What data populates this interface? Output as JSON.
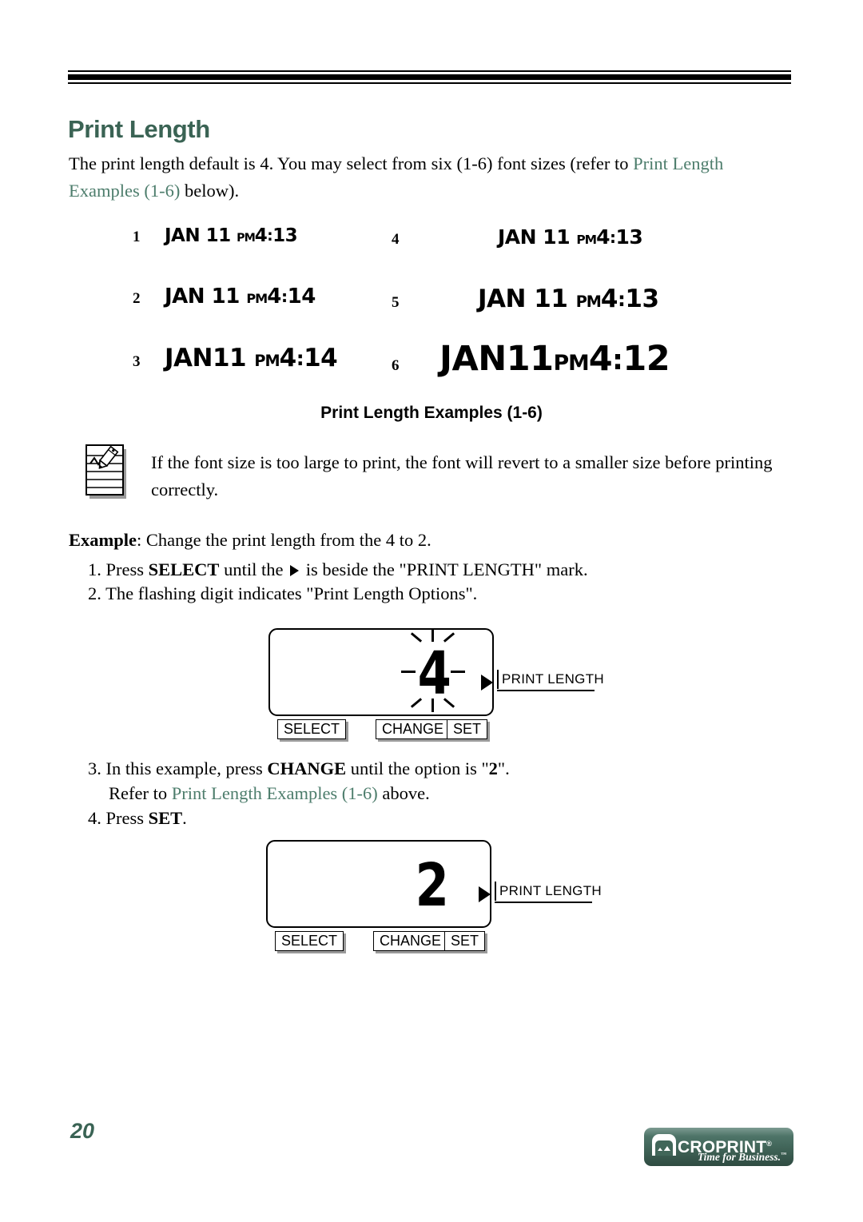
{
  "header": {
    "title": "Print Length"
  },
  "intro": {
    "part1": "The print length default is 4. You may select from six (1-6) font sizes (refer to ",
    "xref": "Print Length Examples (1-6)",
    "part2": " below)."
  },
  "examples": {
    "caption": "Print Length Examples (1-6)",
    "items": [
      {
        "num": "1",
        "month": "JAN",
        "day": "11",
        "meridiem": "PM",
        "hour": "4",
        "minute": "13",
        "text": "JAN 11 PM4:13"
      },
      {
        "num": "2",
        "month": "JAN",
        "day": "11",
        "meridiem": "PM",
        "hour": "4",
        "minute": "14",
        "text": "JAN 11 PM4:14"
      },
      {
        "num": "3",
        "month": "JAN",
        "day": "11",
        "meridiem": "PM",
        "hour": "4",
        "minute": "14",
        "text": "JAN 11 PM4:14"
      },
      {
        "num": "4",
        "month": "JAN",
        "day": "11",
        "meridiem": "PM",
        "hour": "4",
        "minute": "13",
        "text": "JAN 11 PM4:13"
      },
      {
        "num": "5",
        "month": "JAN",
        "day": "11",
        "meridiem": "PM",
        "hour": "4",
        "minute": "13",
        "text": "JAN 11 PM4:13"
      },
      {
        "num": "6",
        "month": "JAN",
        "day": "11",
        "meridiem": "PM",
        "hour": "4",
        "minute": "12",
        "text": "JAN 11 PM4:12"
      }
    ]
  },
  "note": {
    "icon": "notepad-pencil-icon",
    "text": "If the font size is too large to print, the font will revert to a smaller size before printing correctly."
  },
  "procedure": {
    "lead_label": "Example",
    "lead_rest": ": Change the print length from the 4 to 2.",
    "step1_a": "1. Press ",
    "step1_bold": "SELECT",
    "step1_b": " until the ",
    "step1_c": " is beside the \"PRINT LENGTH\" mark.",
    "step2": "2. The flashing digit indicates \"Print Length Options\".",
    "step3_a": "3. In this example, press ",
    "step3_bold": "CHANGE",
    "step3_b": " until the option is \"",
    "step3_value": "2",
    "step3_c": "\".",
    "step3_refer_a": "Refer to ",
    "step3_refer_xref": "Print Length Examples (1-6)",
    "step3_refer_b": " above.",
    "step4_a": "4. Press ",
    "step4_bold": "SET",
    "step4_b": "."
  },
  "display_one": {
    "digit": "4",
    "flashing": true,
    "callout": "PRINT LENGTH",
    "buttons": [
      "SELECT",
      "CHANGE",
      "SET"
    ]
  },
  "display_two": {
    "digit": "2",
    "flashing": false,
    "callout": "PRINT LENGTH",
    "buttons": [
      "SELECT",
      "CHANGE",
      "SET"
    ]
  },
  "footer": {
    "page_number": "20",
    "logo_letter": "A",
    "logo_word": "CROPRINT",
    "logo_reg": "®",
    "logo_tagline": "Time for Business.",
    "logo_tm": "™",
    "brand_color": "#3a6354"
  }
}
